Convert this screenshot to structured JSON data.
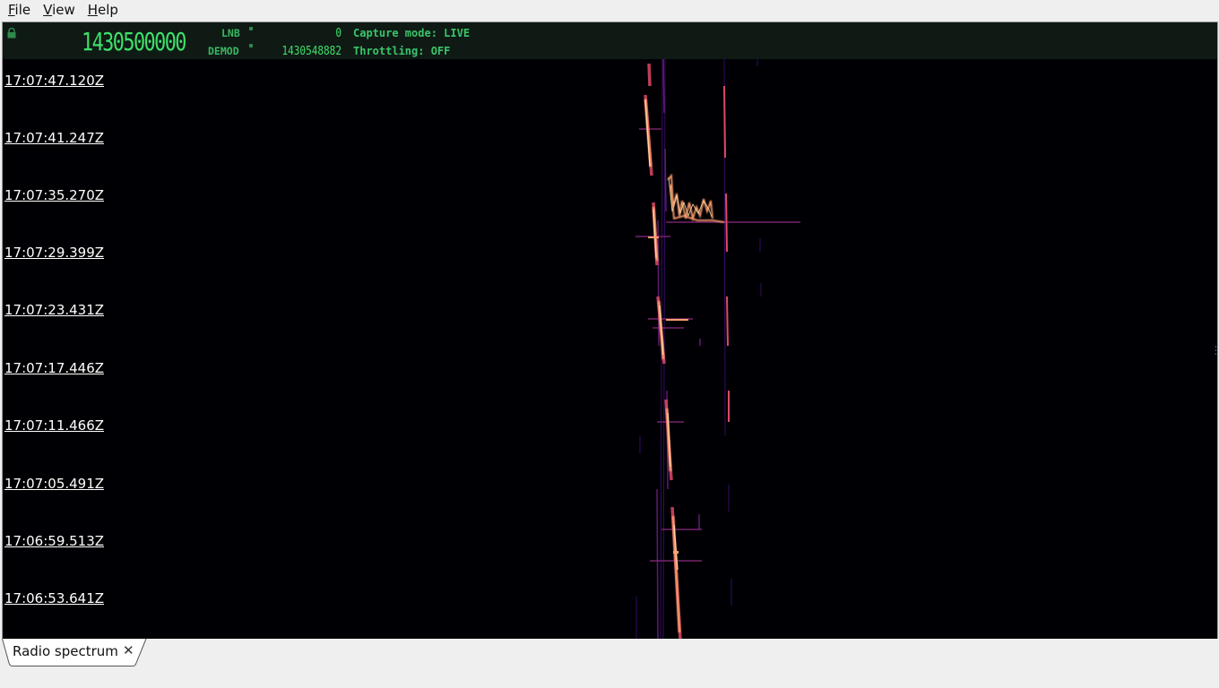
{
  "menubar": {
    "items": [
      {
        "underline": "F",
        "rest": "ile"
      },
      {
        "underline": "V",
        "rest": "iew"
      },
      {
        "underline": "H",
        "rest": "elp"
      }
    ]
  },
  "status": {
    "lock_icon": "padlock-icon",
    "center_freq": "1430500000",
    "lnb_label": "LNB",
    "lnb_value": "0",
    "demod_label": "DEMOD",
    "demod_value": "1430548882",
    "capture_mode": "Capture mode: LIVE",
    "throttling": "Throttling: OFF",
    "text_color": "#3ee06a"
  },
  "waterfall": {
    "timestamps": [
      "17:07:47.120Z",
      "17:07:41.247Z",
      "17:07:35.270Z",
      "17:07:29.399Z",
      "17:07:23.431Z",
      "17:07:17.446Z",
      "17:07:11.466Z",
      "17:07:05.491Z",
      "17:06:59.513Z",
      "17:06:53.641Z"
    ],
    "colormap": [
      "#000000",
      "#3b0f70",
      "#8c2981",
      "#de4968",
      "#fe9f6d",
      "#fcfdbf"
    ]
  },
  "tabs": [
    {
      "label": "Radio spectrum",
      "close_icon": "close-icon"
    }
  ]
}
